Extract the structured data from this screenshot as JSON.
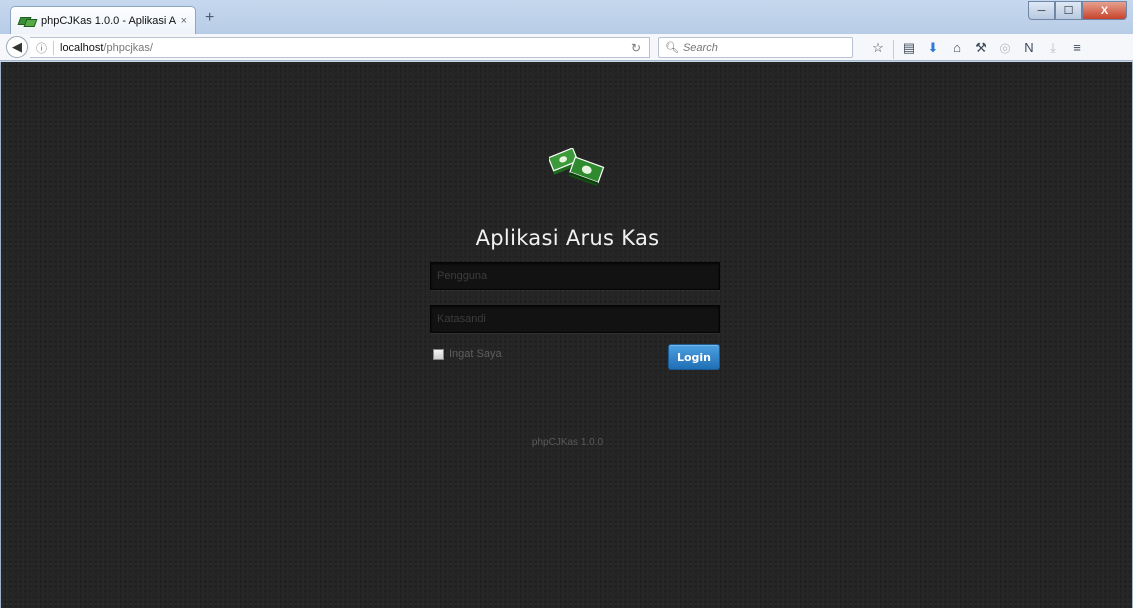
{
  "browser": {
    "tab_title": "phpCJKas 1.0.0 - Aplikasi A...",
    "tab_close": "×",
    "new_tab": "+",
    "url_host": "localhost",
    "url_path": "/phpcjkas/",
    "search_placeholder": "Search",
    "window_buttons": {
      "minimize": "─",
      "maximize": "☐",
      "close": "X"
    }
  },
  "toolbar_icons": [
    "star-icon",
    "reading-list-icon",
    "download-arrow-icon",
    "home-icon",
    "tools-icon",
    "circle-icon",
    "n-icon",
    "downloads-icon",
    "menu-icon"
  ],
  "login": {
    "app_title": "Aplikasi Arus Kas",
    "username_placeholder": "Pengguna",
    "password_placeholder": "Katasandi",
    "remember_label": "Ingat Saya",
    "login_button": "Login",
    "version": "phpCJKas 1.0.0"
  },
  "colors": {
    "page_bg": "#252525",
    "button_blue": "#2f86cc",
    "money_green": "#2e8b2e"
  }
}
